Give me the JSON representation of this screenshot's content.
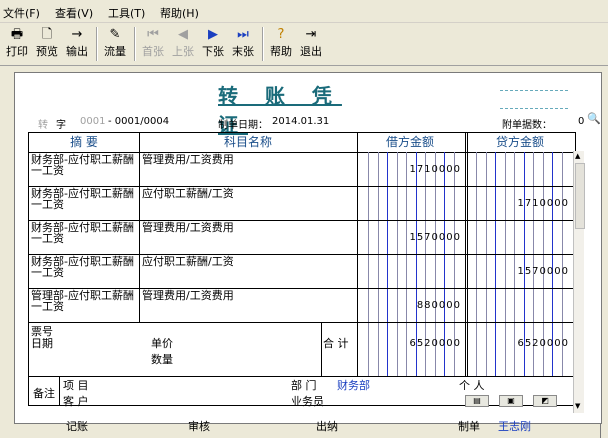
{
  "menu": {
    "file": "文件(F)",
    "view": "查看(V)",
    "tools": "工具(T)",
    "help": "帮助(H)"
  },
  "toolbar": {
    "print": "打印",
    "preview": "预览",
    "export": "输出",
    "flow": "流量",
    "first": "首张",
    "prev": "上张",
    "next": "下张",
    "last": "末张",
    "help": "帮助",
    "exit": "退出"
  },
  "voucher": {
    "title": "转 账 凭 证",
    "type_label": "转",
    "number_label": "字",
    "number_hint": "0001",
    "number_value": "- 0001/0004",
    "date_label": "制单日期：",
    "date_value": "2014.01.31",
    "attach_label": "附单据数：",
    "attach_value": "0"
  },
  "table": {
    "headers": [
      "摘 要",
      "科目名称",
      "借方金额",
      "贷方金额"
    ],
    "rows": [
      {
        "summary": "财务部-应付职工薪酬一工资",
        "account": "管理费用/工资费用",
        "debit": "1710000",
        "credit": ""
      },
      {
        "summary": "财务部-应付职工薪酬一工资",
        "account": "应付职工薪酬/工资",
        "debit": "",
        "credit": "1710000"
      },
      {
        "summary": "财务部-应付职工薪酬一工资",
        "account": "管理费用/工资费用",
        "debit": "1570000",
        "credit": ""
      },
      {
        "summary": "财务部-应付职工薪酬一工资",
        "account": "应付职工薪酬/工资",
        "debit": "",
        "credit": "1570000"
      },
      {
        "summary": "管理部-应付职工薪酬一工资",
        "account": "管理费用/工资费用",
        "debit": "880000",
        "credit": ""
      }
    ],
    "summary_block": {
      "ticket_no": "票号",
      "date": "日期",
      "unit_price": "单价",
      "quantity": "数量",
      "total_label": "合 计",
      "total_debit": "6520000",
      "total_credit": "6520000"
    },
    "notes": {
      "label": "备注",
      "project": "项 目",
      "customer": "客 户",
      "department_label": "部 门",
      "department_value": "财务部",
      "person_label": "个 人",
      "salesperson_label": "业务员"
    }
  },
  "footer": {
    "bookkeeping": "记账",
    "audit": "审核",
    "cashier": "出纳",
    "maker_label": "制单",
    "maker_value": "王志刚"
  },
  "colors": {
    "title": "#1a6b7a",
    "header": "#1a4e8a",
    "blue_value": "#1a3fc0",
    "debit_line_blue": "#2233cc",
    "debit_line_red": "#cc2222"
  },
  "icons": [
    "printer-icon",
    "preview-icon",
    "export-icon",
    "flow-icon",
    "first-icon",
    "prev-icon",
    "next-icon",
    "last-icon",
    "help-icon",
    "exit-icon",
    "search-icon"
  ]
}
